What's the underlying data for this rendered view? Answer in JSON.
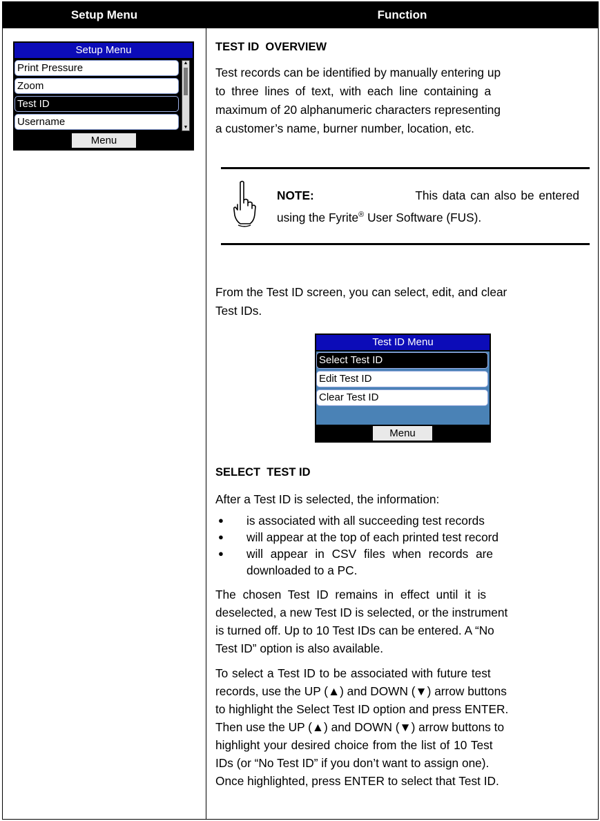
{
  "table": {
    "col1_header": "Setup Menu",
    "col2_header": "Function"
  },
  "setup_screen": {
    "title": "Setup Menu",
    "items": [
      "Print Pressure",
      "Zoom",
      "Test ID",
      "Username"
    ],
    "selected_index": 2,
    "menu_button": "Menu"
  },
  "overview": {
    "heading": "TEST ID  OVERVIEW",
    "para1_lines": [
      "Test records can be identified by manually entering up",
      "to three lines of text, with each line containing a",
      "maximum of 20 alphanumeric characters representing",
      "a customer’s name, burner number, location, etc."
    ],
    "note_label": "NOTE:",
    "note_line1_rest": "This data can also be entered",
    "note_line2_pre": "using the Fyrite",
    "note_reg": "®",
    "note_line2_post": " User Software (FUS).",
    "hand_icon": "pointing-hand-icon",
    "para2_lines": [
      "From the Test ID screen, you can select, edit, and clear",
      "Test IDs."
    ]
  },
  "testid_screen": {
    "title": "Test ID Menu",
    "items": [
      "Select Test ID",
      "Edit Test ID",
      "Clear Test ID"
    ],
    "selected_index": 0,
    "menu_button": "Menu",
    "panel_color": "#4a82b6"
  },
  "select": {
    "heading": "SELECT  TEST ID",
    "intro": "After a Test ID is selected, the information:",
    "bullets": [
      "is associated with all succeeding test records",
      "will appear at the top of each printed test record"
    ],
    "bullet3_lines": [
      "will appear in CSV files when records are",
      "downloaded to a PC."
    ],
    "para3_lines": [
      "The chosen Test ID remains in effect until it is",
      "deselected, a new Test ID is selected, or the instrument",
      "is turned off.  Up to 10 Test IDs can be entered.  A “No",
      "Test ID” option is also available."
    ],
    "para4_lines": [
      "To select a Test ID to be associated with future test",
      "records, use the UP (▲) and DOWN (▼) arrow buttons",
      "to highlight the Select Test ID option and press ENTER.",
      "Then use the UP (▲) and DOWN (▼) arrow buttons to",
      "highlight your desired choice from the list of 10 Test",
      "IDs (or “No Test ID” if you don’t want to assign one).",
      "Once highlighted, press ENTER to select that Test ID."
    ]
  }
}
